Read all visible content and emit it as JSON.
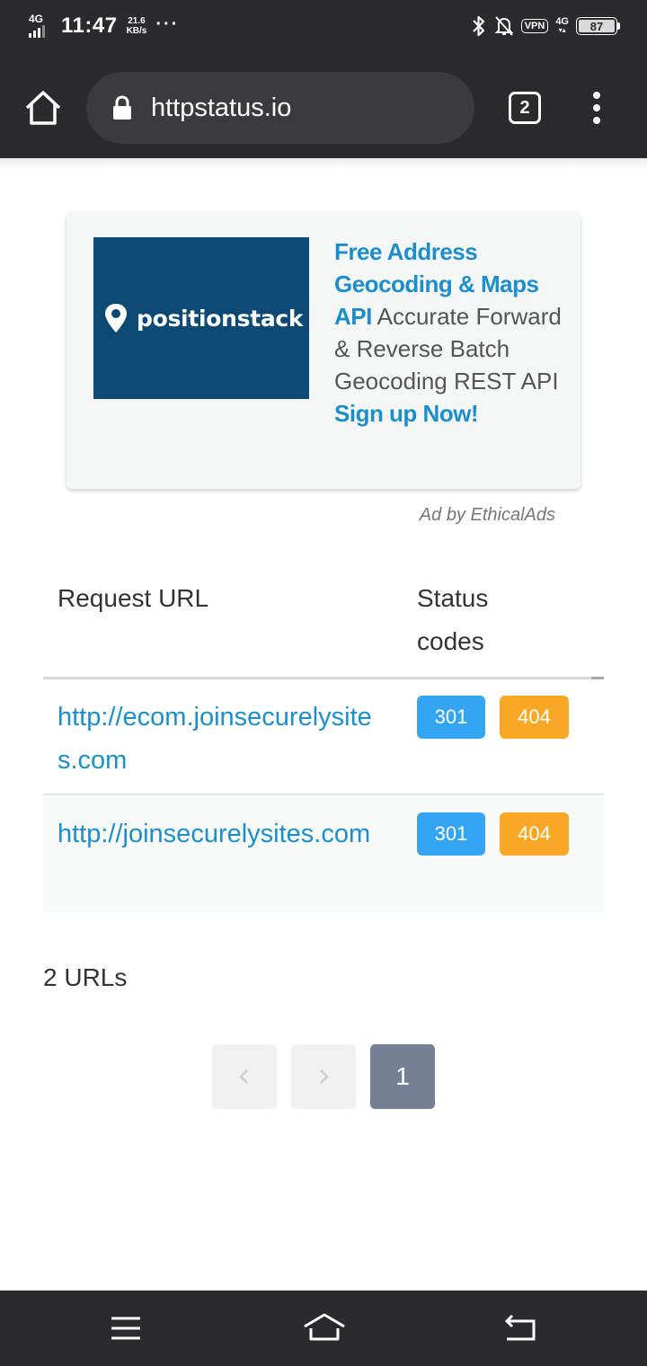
{
  "status_bar": {
    "network": "4G",
    "time": "11:47",
    "speed_value": "21.6",
    "speed_unit": "KB/s",
    "more": "···",
    "vpn": "VPN",
    "network_right": "4G",
    "battery": "87"
  },
  "browser": {
    "url": "httpstatus.io",
    "tab_count": "2"
  },
  "ad": {
    "brand": "positionstack",
    "headline": "Free Address Geocoding & Maps API",
    "body": " Accurate Forward & Reverse Batch Geocoding REST API ",
    "cta": "Sign up Now!",
    "credit": "Ad by EthicalAds"
  },
  "table": {
    "headers": [
      "Request URL",
      "Status codes"
    ],
    "rows": [
      {
        "url": "http://ecom.joinsecurelysites.com",
        "codes": [
          "301",
          "404"
        ]
      },
      {
        "url": "http://joinsecurelysites.com",
        "codes": [
          "301",
          "404"
        ]
      }
    ]
  },
  "summary": "2 URLs",
  "pagination": {
    "current": "1"
  },
  "colors": {
    "link": "#1d8ecc",
    "code_301": "#33a5f2",
    "code_404": "#f9a825",
    "page_active": "#758094"
  }
}
